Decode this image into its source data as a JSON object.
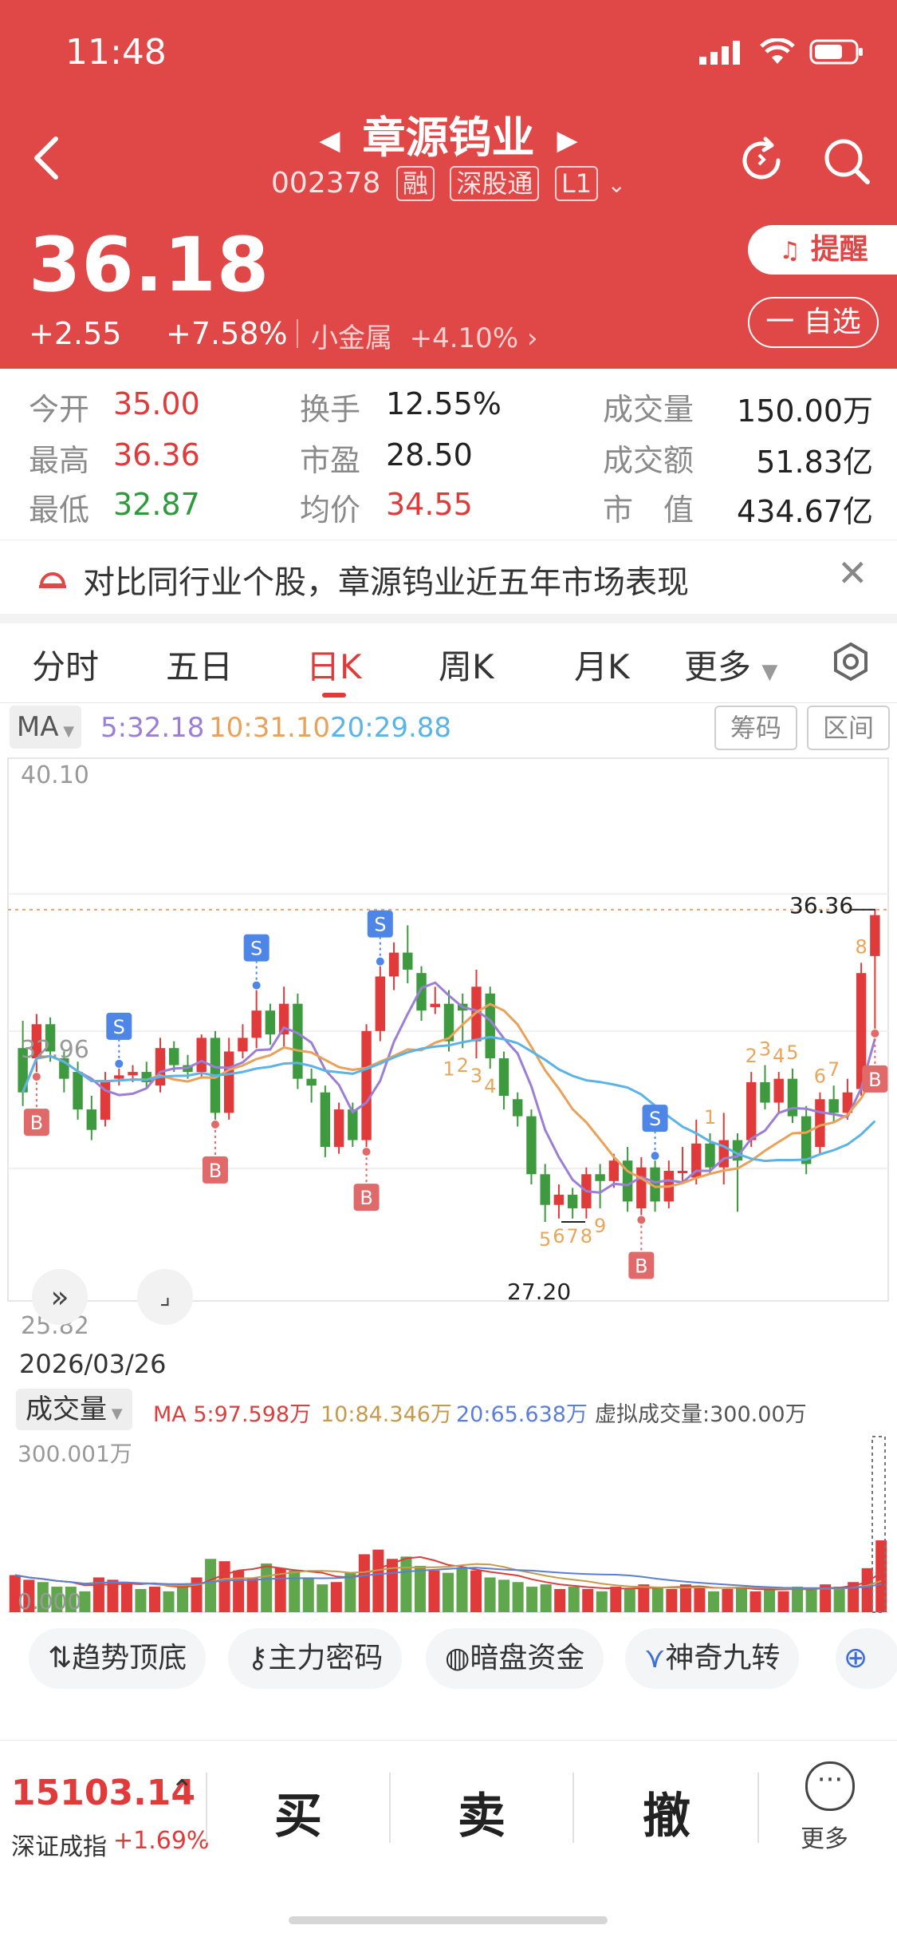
{
  "status_bar": {
    "time": "11:48"
  },
  "header": {
    "stock_name": "章源钨业",
    "stock_code": "002378",
    "tags": [
      "融",
      "深股通",
      "L1"
    ],
    "price": "36.18",
    "change": "+2.55",
    "change_pct": "+7.58%",
    "sector_name": "小金属",
    "sector_change": "+4.10%",
    "remind_label": "提醒",
    "watchlist_label": "一 自选",
    "prev_arrow": "◀",
    "next_arrow": "▶"
  },
  "quote": {
    "open_label": "今开",
    "open": "35.00",
    "high_label": "最高",
    "high": "36.36",
    "low_label": "最低",
    "low": "32.87",
    "turnover_label": "换手",
    "turnover": "12.55%",
    "pe_label": "市盈",
    "pe": "28.50",
    "avg_label": "均价",
    "avg": "34.55",
    "volume_label": "成交量",
    "volume": "150.00万",
    "amount_label": "成交额",
    "amount": "51.83亿",
    "mcap_label": "市　值",
    "mcap": "434.67亿"
  },
  "banner": {
    "text": "对比同行业个股，章源钨业近五年市场表现"
  },
  "tabs": {
    "items": [
      "分时",
      "五日",
      "日K",
      "周K",
      "月K",
      "更多"
    ],
    "active": "日K"
  },
  "ma": {
    "selector": "MA",
    "ma5": "5:32.18",
    "ma10": "10:31.10",
    "ma20": "20:29.88",
    "chip_button": "筹码",
    "range_button": "区间",
    "colors": {
      "ma5": "#9B7FD6",
      "ma10": "#E8A25A",
      "ma20": "#5BB3E6"
    }
  },
  "chart_data": {
    "type": "candlestick",
    "y_top_label": "40.10",
    "y_bottom_label": "25.82",
    "mid_label": "32.96",
    "high_marker": "36.36",
    "low_marker": "27.20",
    "date": "2026/03/26",
    "ylim": [
      25.82,
      40.1
    ],
    "candles": [
      [
        32.3,
        31.0,
        33.1,
        30.6
      ],
      [
        32.0,
        33.0,
        33.3,
        31.6
      ],
      [
        33.0,
        32.2,
        33.2,
        31.9
      ],
      [
        32.0,
        31.4,
        32.2,
        31.0
      ],
      [
        31.6,
        30.5,
        31.9,
        30.2
      ],
      [
        30.5,
        29.9,
        30.9,
        29.6
      ],
      [
        30.2,
        31.3,
        31.6,
        30.0
      ],
      [
        31.4,
        31.5,
        31.7,
        31.2
      ],
      [
        31.5,
        31.6,
        31.8,
        31.3
      ],
      [
        31.6,
        31.3,
        31.9,
        31.1
      ],
      [
        31.2,
        32.3,
        32.6,
        31.0
      ],
      [
        32.3,
        31.8,
        32.5,
        31.6
      ],
      [
        31.8,
        31.6,
        32.1,
        31.4
      ],
      [
        31.6,
        32.6,
        32.7,
        31.4
      ],
      [
        32.6,
        30.4,
        32.8,
        30.2
      ],
      [
        30.4,
        32.2,
        32.6,
        30.2
      ],
      [
        32.2,
        32.6,
        33.0,
        32.0
      ],
      [
        32.6,
        33.4,
        34.0,
        32.3
      ],
      [
        33.4,
        32.7,
        33.6,
        32.4
      ],
      [
        32.7,
        33.6,
        34.1,
        32.3
      ],
      [
        33.6,
        31.4,
        33.9,
        31.1
      ],
      [
        31.4,
        31.2,
        31.7,
        30.7
      ],
      [
        31.0,
        29.4,
        31.2,
        29.1
      ],
      [
        29.4,
        30.5,
        30.7,
        29.2
      ],
      [
        30.5,
        29.6,
        30.7,
        29.4
      ],
      [
        29.6,
        32.8,
        33.0,
        29.4
      ],
      [
        32.8,
        34.4,
        34.7,
        32.5
      ],
      [
        34.4,
        35.1,
        35.4,
        34.0
      ],
      [
        35.1,
        34.6,
        35.9,
        34.2
      ],
      [
        34.5,
        33.4,
        34.7,
        33.1
      ],
      [
        33.5,
        33.6,
        34.1,
        33.3
      ],
      [
        33.6,
        32.5,
        34.0,
        32.2
      ],
      [
        33.6,
        33.4,
        33.9,
        32.3
      ],
      [
        32.5,
        34.1,
        34.6,
        32.0
      ],
      [
        33.9,
        32.0,
        34.1,
        31.7
      ],
      [
        32.0,
        30.9,
        32.2,
        30.5
      ],
      [
        30.8,
        30.3,
        31.0,
        30.0
      ],
      [
        30.3,
        28.6,
        30.5,
        28.3
      ],
      [
        28.6,
        27.7,
        28.9,
        27.2
      ],
      [
        27.7,
        28.0,
        28.3,
        27.3
      ],
      [
        28.0,
        27.6,
        28.2,
        27.3
      ],
      [
        27.6,
        28.6,
        28.8,
        27.3
      ],
      [
        28.6,
        28.4,
        28.9,
        27.6
      ],
      [
        28.4,
        29.0,
        29.2,
        28.2
      ],
      [
        29.0,
        27.8,
        29.4,
        27.5
      ],
      [
        27.6,
        28.8,
        29.1,
        27.4
      ],
      [
        28.8,
        27.8,
        29.0,
        27.5
      ],
      [
        27.8,
        28.7,
        29.0,
        27.6
      ],
      [
        28.7,
        28.7,
        29.4,
        28.4
      ],
      [
        28.5,
        29.5,
        30.2,
        28.3
      ],
      [
        29.5,
        28.8,
        29.8,
        28.6
      ],
      [
        28.8,
        29.6,
        30.4,
        28.3
      ],
      [
        29.6,
        29.0,
        29.8,
        27.5
      ],
      [
        29.6,
        31.3,
        31.6,
        29.4
      ],
      [
        31.3,
        30.7,
        31.8,
        30.5
      ],
      [
        30.7,
        31.4,
        31.6,
        30.4
      ],
      [
        31.4,
        30.3,
        31.7,
        30.1
      ],
      [
        30.3,
        28.9,
        30.6,
        28.6
      ],
      [
        29.4,
        30.8,
        31.0,
        29.2
      ],
      [
        30.8,
        30.4,
        31.2,
        30.1
      ],
      [
        30.4,
        31.0,
        31.4,
        30.2
      ],
      [
        31.1,
        34.5,
        34.8,
        30.9
      ],
      [
        35.0,
        36.2,
        36.36,
        32.87
      ]
    ],
    "buy_sell_markers": [
      {
        "i": 1,
        "type": "B"
      },
      {
        "i": 7,
        "type": "S"
      },
      {
        "i": 14,
        "type": "B"
      },
      {
        "i": 17,
        "type": "S"
      },
      {
        "i": 25,
        "type": "B"
      },
      {
        "i": 26,
        "type": "S"
      },
      {
        "i": 45,
        "type": "B"
      },
      {
        "i": 46,
        "type": "S"
      },
      {
        "i": 62,
        "type": "B"
      }
    ],
    "td_counts": [
      {
        "i": 31,
        "n": "1"
      },
      {
        "i": 32,
        "n": "2"
      },
      {
        "i": 33,
        "n": "3"
      },
      {
        "i": 34,
        "n": "4"
      },
      {
        "i": 38,
        "n": "5"
      },
      {
        "i": 39,
        "n": "6"
      },
      {
        "i": 40,
        "n": "7"
      },
      {
        "i": 41,
        "n": "8"
      },
      {
        "i": 42,
        "n": "9"
      },
      {
        "i": 50,
        "n": "1"
      },
      {
        "i": 53,
        "n": "2"
      },
      {
        "i": 54,
        "n": "3"
      },
      {
        "i": 55,
        "n": "4"
      },
      {
        "i": 56,
        "n": "5"
      },
      {
        "i": 58,
        "n": "6"
      },
      {
        "i": 59,
        "n": "7"
      },
      {
        "i": 61,
        "n": "8"
      }
    ]
  },
  "volume": {
    "label": "成交量",
    "ma5": "MA 5:97.598万",
    "ma10": "10:84.346万",
    "ma20": "20:65.638万",
    "virtual": "虚拟成交量:300.00万",
    "top_label": "300.001万",
    "zero_label": "0.000",
    "bars": [
      32,
      28,
      26,
      22,
      22,
      18,
      30,
      28,
      25,
      20,
      22,
      18,
      24,
      30,
      46,
      44,
      36,
      30,
      42,
      38,
      36,
      30,
      24,
      26,
      34,
      50,
      54,
      46,
      48,
      40,
      36,
      34,
      38,
      36,
      30,
      28,
      26,
      22,
      24,
      20,
      22,
      20,
      18,
      22,
      20,
      24,
      22,
      20,
      24,
      22,
      18,
      20,
      22,
      18,
      20,
      18,
      22,
      20,
      24,
      22,
      26,
      38,
      62
    ],
    "up": [
      true,
      true,
      false,
      false,
      false,
      false,
      true,
      true,
      true,
      false,
      true,
      false,
      false,
      true,
      false,
      true,
      true,
      true,
      false,
      true,
      false,
      false,
      false,
      true,
      false,
      true,
      true,
      true,
      false,
      false,
      true,
      false,
      false,
      true,
      false,
      false,
      false,
      false,
      false,
      true,
      false,
      true,
      false,
      true,
      false,
      true,
      false,
      true,
      true,
      true,
      false,
      true,
      false,
      true,
      false,
      true,
      false,
      false,
      true,
      false,
      true,
      true,
      true
    ]
  },
  "tools": [
    "趋势顶底",
    "主力密码",
    "暗盘资金",
    "神奇九转"
  ],
  "bottom": {
    "index_value": "15103.14",
    "index_name": "深证成指",
    "index_change": "+1.69%",
    "buy": "买",
    "sell": "卖",
    "cancel": "撤",
    "more": "更多"
  }
}
